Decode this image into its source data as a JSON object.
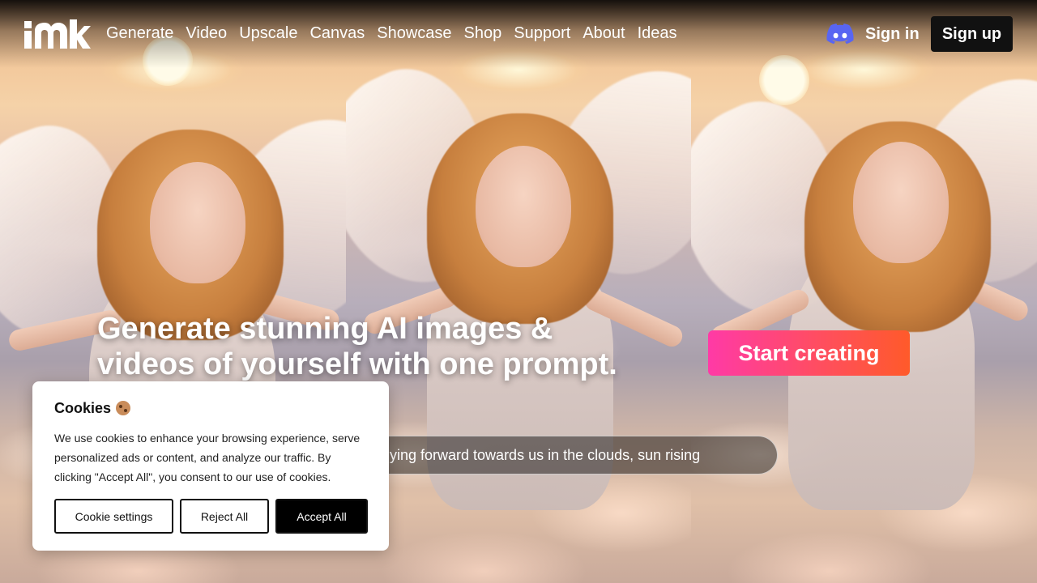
{
  "header": {
    "logo_text": "mk",
    "nav": [
      "Generate",
      "Video",
      "Upscale",
      "Canvas",
      "Showcase",
      "Shop",
      "Support",
      "About",
      "Ideas"
    ],
    "discord_icon": "discord-icon",
    "signin_label": "Sign in",
    "signup_label": "Sign up"
  },
  "hero": {
    "headline_line1": "Generate stunning AI images &",
    "headline_line2": "videos of yourself with one prompt.",
    "cta_label": "Start creating",
    "prompt_text": "lying forward towards us in the clouds, sun rising"
  },
  "cookie": {
    "title": "Cookies",
    "body": "We use cookies to enhance your browsing experience, serve personalized ads or content, and analyze our traffic. By clicking \"Accept All\", you consent to our use of cookies.",
    "settings_label": "Cookie settings",
    "reject_label": "Reject All",
    "accept_label": "Accept All"
  },
  "colors": {
    "cta_gradient_start": "#ff3aa6",
    "cta_gradient_end": "#ff5a2a",
    "signup_bg": "#111111",
    "discord": "#5865F2"
  }
}
